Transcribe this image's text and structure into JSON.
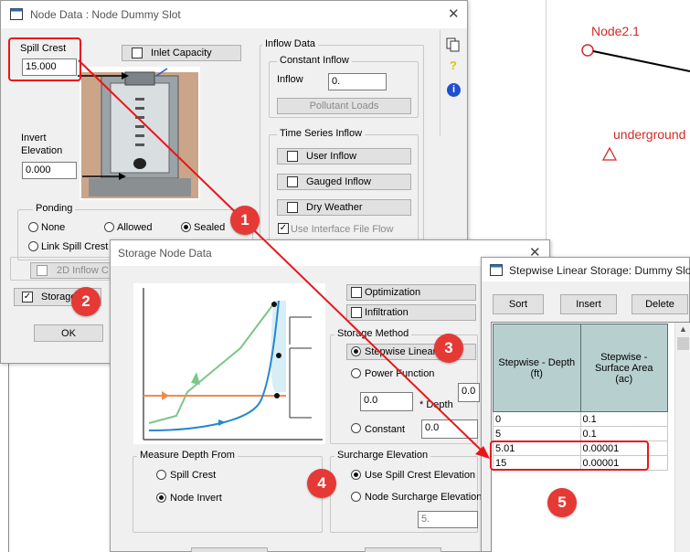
{
  "map": {
    "node_label": "Node2.1",
    "underground_label": "underground",
    "colors": {
      "node": "#d12a2a"
    }
  },
  "node_dialog": {
    "title": "Node Data : Node Dummy Slot",
    "spill_crest_label": "Spill Crest",
    "spill_crest_value": "15.000",
    "inlet_capacity_label": "Inlet Capacity",
    "invert_elevation_label": "Invert\nElevation",
    "invert_elevation_value": "0.000",
    "inflow_data_label": "Inflow Data",
    "constant_inflow_label": "Constant Inflow",
    "inflow_label": "Inflow",
    "inflow_value": "0.",
    "pollutant_loads_label": "Pollutant Loads",
    "time_series_inflow_label": "Time Series Inflow",
    "user_inflow_label": "User Inflow",
    "gauged_inflow_label": "Gauged Inflow",
    "dry_weather_label": "Dry Weather",
    "use_interface_file_flow_label": "Use Interface File Flow",
    "ponding_label": "Ponding",
    "ponding_none": "None",
    "ponding_allowed": "Allowed",
    "ponding_sealed": "Sealed",
    "link_spill_crest_label": "Link Spill Crest t",
    "inflow_2d_label": "2D Inflow C",
    "storage_label": "Storage",
    "ok_label": "OK"
  },
  "storage_dialog": {
    "title": "Storage Node Data",
    "optimization_label": "Optimization",
    "infiltration_label": "Infiltration",
    "storage_method_label": "Storage Method",
    "stepwise_linear_label": "Stepwise Linear",
    "power_function_label": "Power Function",
    "power_coeff_value": "0.0",
    "depth_label": "* Depth",
    "power_exp_value": "0.0",
    "constant_label": "Constant",
    "constant_value": "0.0",
    "measure_depth_from_label": "Measure Depth From",
    "spill_crest_option": "Spill Crest",
    "node_invert_option": "Node Invert",
    "surcharge_elevation_label": "Surcharge Elevation",
    "use_spill_crest_elevation_label": "Use Spill Crest Elevation",
    "node_surcharge_elevation_label": "Node Surcharge Elevation",
    "surcharge_value": "5."
  },
  "stepwise_dialog": {
    "title": "Stepwise Linear Storage: Dummy Slot",
    "sort_label": "Sort",
    "insert_label": "Insert",
    "delete_label": "Delete",
    "col_depth": "Stepwise - Depth\n(ft)",
    "col_area": "Stepwise -\nSurface Area\n(ac)",
    "rows": [
      {
        "depth": "0",
        "area": "0.1"
      },
      {
        "depth": "5",
        "area": "0.1"
      },
      {
        "depth": "5.01",
        "area": "0.00001"
      },
      {
        "depth": "15",
        "area": "0.00001"
      }
    ]
  },
  "badges": [
    "1",
    "2",
    "3",
    "4",
    "5"
  ],
  "colors": {
    "annotation_red": "#e8161b",
    "badge_red": "#e53935",
    "header_teal": "#b7cfcf"
  }
}
